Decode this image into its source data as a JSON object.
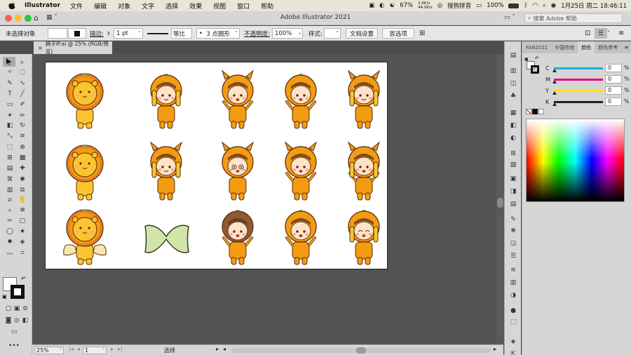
{
  "menubar": {
    "app_name": "Illustrator",
    "items": [
      "文件",
      "编辑",
      "对象",
      "文字",
      "选择",
      "效果",
      "视图",
      "窗口",
      "帮助"
    ],
    "battery_pct": "67%",
    "net_up": "2.6K/s",
    "net_down": "44.5K/s",
    "ime": "搜狗拼音",
    "battery2": "100%",
    "datetime": "1月25日 周二  18:46:11"
  },
  "titlebar": {
    "title": "Adobe Illustrator 2021",
    "search_placeholder": "搜索 Adobe 帮助"
  },
  "control": {
    "selection": "未选择对象",
    "stroke_label": "描边:",
    "stroke_weight": "1 pt",
    "line_style": "等比",
    "brush": "3 点圆形",
    "opacity_label": "不透明度:",
    "opacity": "100%",
    "style_label": "样式:",
    "doc_setup": "文档设置",
    "prefs": "首选项"
  },
  "document": {
    "tab_title": "狮子IP.ai @ 25% (RGB/预览)"
  },
  "status": {
    "zoom": "25%",
    "artboard": "1",
    "tool": "选择"
  },
  "panel": {
    "tabs": [
      "FAN2022",
      "中国传统",
      "颜色",
      "颜色参考"
    ],
    "active_tab": "颜色",
    "sliders": [
      {
        "label": "C",
        "value": "0",
        "color": "#00b4e6"
      },
      {
        "label": "M",
        "value": "0",
        "color": "#e6007e"
      },
      {
        "label": "Y",
        "value": "0",
        "color": "#ffe600"
      },
      {
        "label": "K",
        "value": "0",
        "color": "#222222"
      }
    ],
    "percent": "%"
  },
  "artboard": {
    "characters": [
      {
        "kind": "lion",
        "face": "smile"
      },
      {
        "kind": "girl",
        "face": "smile"
      },
      {
        "kind": "boy-horns",
        "face": "happy"
      },
      {
        "kind": "boy",
        "face": "open"
      },
      {
        "kind": "girl-horns",
        "face": "smile"
      },
      {
        "kind": "lion",
        "face": "frown"
      },
      {
        "kind": "girl-horns",
        "face": "smile"
      },
      {
        "kind": "boy-horns",
        "face": "surprised"
      },
      {
        "kind": "boy-horns",
        "face": "open"
      },
      {
        "kind": "girl-horns",
        "face": "open"
      },
      {
        "kind": "lion-wings",
        "face": "smile"
      },
      {
        "kind": "bow",
        "face": ""
      },
      {
        "kind": "boy-brown",
        "face": "open"
      },
      {
        "kind": "boy",
        "face": "open"
      },
      {
        "kind": "girl",
        "face": "laugh"
      }
    ]
  }
}
